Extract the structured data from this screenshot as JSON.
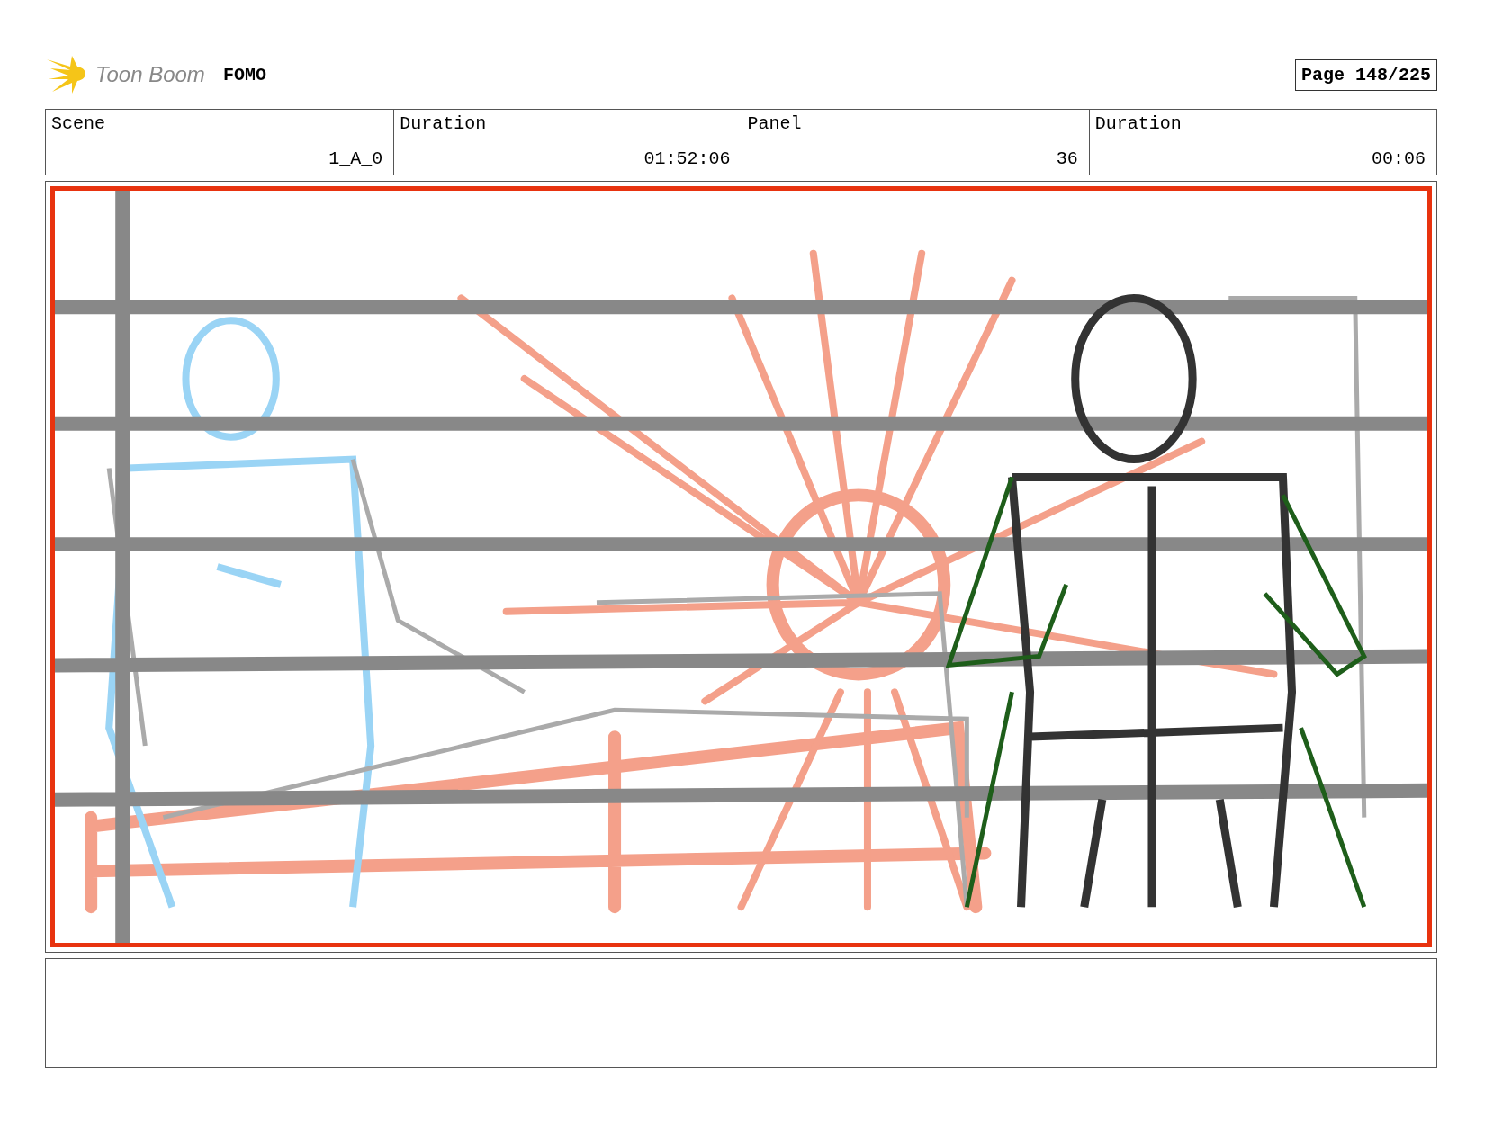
{
  "header": {
    "logo": "Toon Boom",
    "project": "FOMO",
    "page": "Page 148/225"
  },
  "fields": [
    {
      "label": "Scene",
      "value": "1_A_0"
    },
    {
      "label": "Duration",
      "value": "01:52:06"
    },
    {
      "label": "Panel",
      "value": "36"
    },
    {
      "label": "Duration",
      "value": "00:06"
    }
  ]
}
